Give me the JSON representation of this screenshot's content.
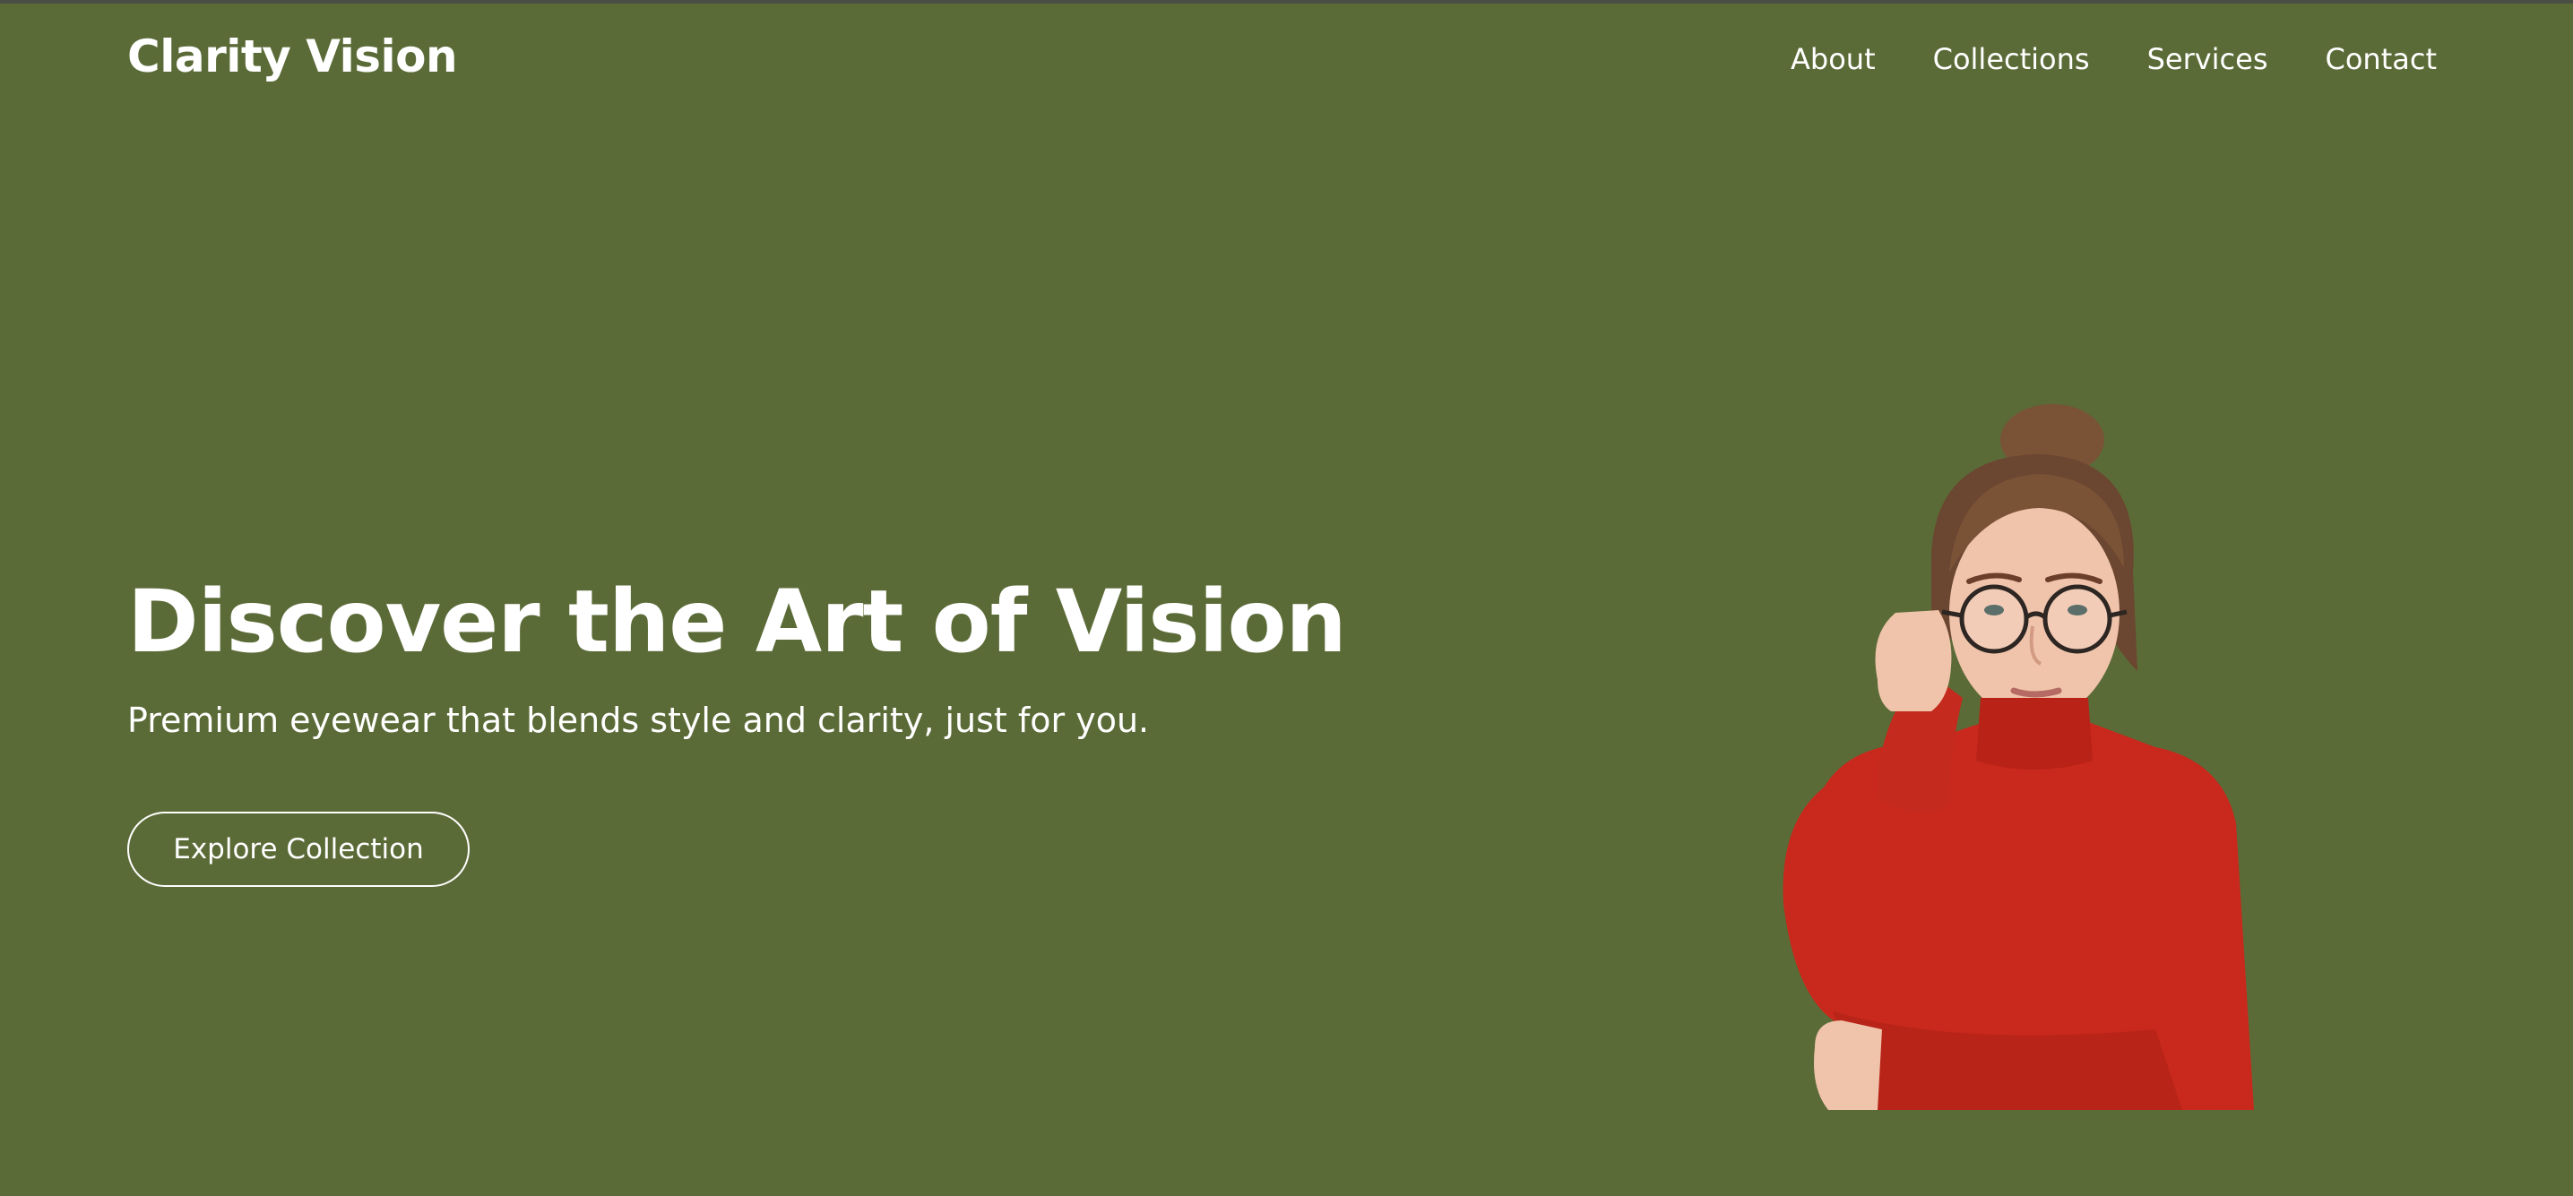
{
  "brand": {
    "name": "Clarity Vision"
  },
  "nav": {
    "items": [
      {
        "label": "About"
      },
      {
        "label": "Collections"
      },
      {
        "label": "Services"
      },
      {
        "label": "Contact"
      }
    ]
  },
  "hero": {
    "headline": "Discover the Art of Vision",
    "tagline": "Premium eyewear that blends style and clarity, just for you.",
    "cta_label": "Explore Collection",
    "image": "woman-with-round-glasses-red-turtleneck"
  },
  "colors": {
    "background": "#5b6b37",
    "text": "#ffffff",
    "sweater": "#c9281c",
    "hair": "#7a5236"
  }
}
